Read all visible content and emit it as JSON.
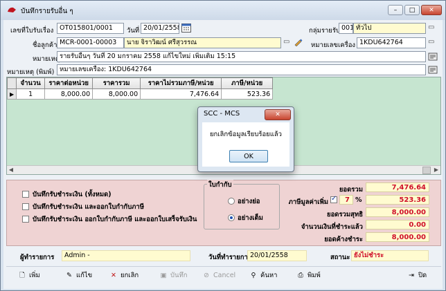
{
  "window": {
    "title": "บันทึกรายรับอื่น ๆ",
    "min": "–",
    "max": "□",
    "close": "✕"
  },
  "form": {
    "doc_no_label": "เลขที่ใบรับเรื่อง",
    "doc_no": "OT015801/0001",
    "date_label": "วันที่",
    "date": "20/01/2558",
    "group_label": "กลุ่มรายรับ",
    "group_code": "001",
    "group_name": "ทั่วไป",
    "customer_label": "ชื่อลูกค้า",
    "customer_code": "MCR-0001-00003",
    "customer_name": "นาย จิราวิฒน์ ศรีสุวรรณ",
    "ref_label": "หมายเลขเครื่อง",
    "ref_value": "1KDU642764",
    "note_label": "หมายเหตุ",
    "note": "รายรับอื่นๆ วันที่ 20 มกราคม 2558 แก้ไขใหม่ เพิ่มเติม 15:15",
    "note_print_label": "หมายเหตุ (พิมพ์)",
    "note_print": "หมายเลขเครื่อง: 1KDU642764"
  },
  "grid": {
    "columns": [
      "จำนวน",
      "ราคาต่อหน่วย",
      "ราคารวม",
      "ราคาไม่รวมภาษี/หน่วย",
      "ภาษี/หน่วย"
    ],
    "rows": [
      [
        "1",
        "8,000.00",
        "8,000.00",
        "7,476.64",
        "523.36"
      ]
    ]
  },
  "options": {
    "pay_all": "บันทึกรับชำระเงิน (ทั้งหมด)",
    "pay_tax_invoice": "บันทึกรับชำระเงิน และออกใบกำกับภาษี",
    "pay_tax_receipt": "บันทึกรับชำระเงิน ออกใบกำกับภาษี และออกใบเสร็จรับเงิน",
    "invoice_group_title": "ใบกำกับ",
    "invoice_short": "อย่างย่อ",
    "invoice_full": "อย่างเต็ม"
  },
  "totals": {
    "total_label": "ยอดรวม",
    "total": "7,476.64",
    "vat_label": "ภาษีมูลค่าเพิ่ม",
    "vat_rate": "7",
    "vat_pct": "%",
    "vat": "523.36",
    "net_label": "ยอดรวมสุทธิ",
    "net": "8,000.00",
    "paid_label": "จำนวนเงินที่ชำระแล้ว",
    "paid": "0.00",
    "balance_label": "ยอดค้างชำระ",
    "balance": "8,000.00"
  },
  "status": {
    "recorder_label": "ผู้ทำรายการ",
    "recorder": "Admin -",
    "record_date_label": "วันที่ทำรายการ",
    "record_date": "20/01/2558",
    "state_label": "สถานะ",
    "state": "ยังไม่ชำระ"
  },
  "toolbar": {
    "add": "เพิ่ม",
    "edit": "แก้ไข",
    "cancel_doc": "ยกเลิก",
    "save": "บันทึก",
    "cancel": "Cancel",
    "search": "ค้นหา",
    "print": "พิมพ์",
    "close": "ปิด"
  },
  "dialog": {
    "title": "SCC - MCS",
    "close": "✕",
    "message": "ยกเลิกข้อมูลเรียบร้อยแล้ว",
    "ok": "OK"
  },
  "colors": {
    "grid_bg": "#c6e5d0",
    "lower_panel_bg": "#efd3d3",
    "value_text": "#d0102a",
    "value_bg": "#fffbd0"
  }
}
